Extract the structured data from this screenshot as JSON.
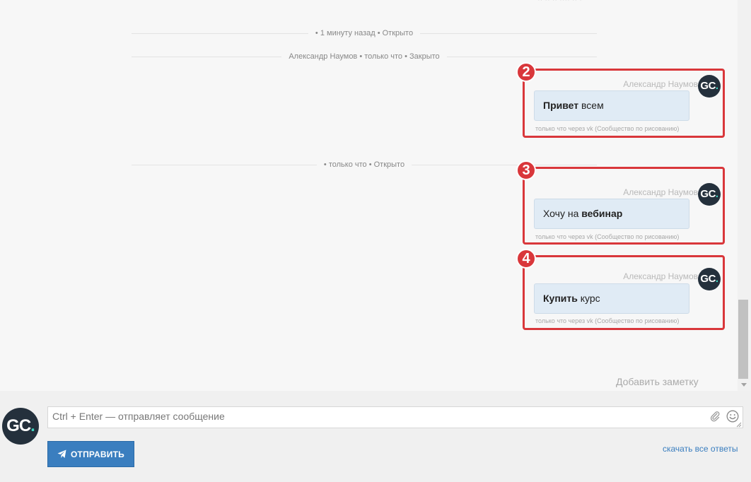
{
  "separators": [
    {
      "label": "• 1 минуту назад • Открыто"
    },
    {
      "label": "Александр Наумов • только что • Закрыто"
    },
    {
      "label": "• только что • Открыто"
    }
  ],
  "messages": [
    {
      "badge": "2",
      "author": "Александр Наумов",
      "text_bold": "Привет",
      "text_rest": " всем",
      "meta": "только что через vk (Сообщество по рисованию)"
    },
    {
      "badge": "3",
      "author": "Александр Наумов",
      "text_plain": "Хочу на ",
      "text_bold": "вебинар",
      "meta": "только что через vk (Сообщество по рисованию)"
    },
    {
      "badge": "4",
      "author": "Александр Наумов",
      "text_bold": "Купить",
      "text_rest": " курс",
      "meta": "только что через vk (Сообщество по рисованию)"
    }
  ],
  "avatar": {
    "letters": "GC",
    "dot": "."
  },
  "add_note": "Добавить заметку",
  "composer": {
    "placeholder": "Ctrl + Enter — отправляет сообщение",
    "send_label": "ОТПРАВИТЬ",
    "download_link": "скачать все ответы"
  },
  "icons": [
    "paperclip-icon",
    "smile-icon",
    "send-plane-icon",
    "resize-grip-icon",
    "scroll-down-arrow-icon"
  ],
  "colors": {
    "highlight": "#d9373b",
    "bubble": "#e0ebf5",
    "accent": "#3a7ebf",
    "avatar_bg": "#24303c",
    "avatar_dot": "#3ed3c0"
  }
}
